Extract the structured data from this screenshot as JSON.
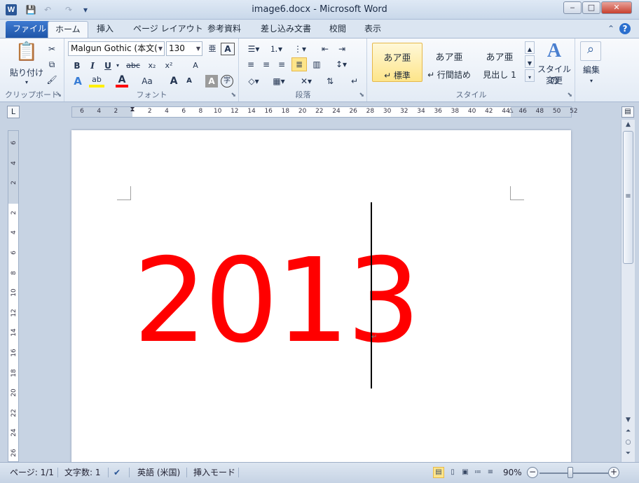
{
  "window": {
    "title": "image6.docx - Microsoft Word",
    "app_icon": "W",
    "controls": {
      "minimize": "‒",
      "maximize": "□",
      "close": "✕"
    }
  },
  "quick_access": {
    "save": "💾",
    "undo": "↶",
    "redo": "↷",
    "customize": "▾"
  },
  "tabs": [
    {
      "label": "ファイル"
    },
    {
      "label": "ホーム"
    },
    {
      "label": "挿入"
    },
    {
      "label": "ページ レイアウト"
    },
    {
      "label": "参考資料"
    },
    {
      "label": "差し込み文書"
    },
    {
      "label": "校閲"
    },
    {
      "label": "表示"
    }
  ],
  "ribbon": {
    "clipboard": {
      "group_label": "クリップボード",
      "paste_label": "貼り付け",
      "cut_icon": "✂",
      "copy_icon": "⧉",
      "painter_icon": "🖌"
    },
    "font": {
      "group_label": "フォント",
      "font_name": "Malgun Gothic (本文(",
      "font_size": "130",
      "bold": "B",
      "italic": "I",
      "underline": "U",
      "strike": "abc",
      "subscript": "x₂",
      "superscript": "x²",
      "grow": "A",
      "shrink": "A",
      "case": "Aa",
      "clear": "A",
      "phonetic": "亜",
      "border_char": "A",
      "enclose": "字",
      "text_effect": "A",
      "highlight": "ab",
      "font_color": "A",
      "char_shading": "A"
    },
    "paragraph": {
      "group_label": "段落"
    },
    "styles": {
      "group_label": "スタイル",
      "items": [
        {
          "sample": "あア亜",
          "name": "↵ 標準"
        },
        {
          "sample": "あア亜",
          "name": "↵ 行間詰め"
        },
        {
          "sample": "あア亜",
          "name": "見出し 1"
        }
      ],
      "change_label_1": "スタイルの",
      "change_label_2": "変更"
    },
    "editing": {
      "label": "編集"
    }
  },
  "rulers": {
    "horizontal_ticks": [
      "6",
      "4",
      "2",
      "2",
      "4",
      "6",
      "8",
      "10",
      "12",
      "14",
      "16",
      "18",
      "20",
      "22",
      "24",
      "26",
      "28",
      "30",
      "32",
      "34",
      "36",
      "38",
      "40",
      "42",
      "44",
      "46",
      "48",
      "50",
      "52"
    ],
    "vertical_ticks": [
      "6",
      "4",
      "2",
      "2",
      "4",
      "6",
      "8",
      "10",
      "12",
      "14",
      "16",
      "18",
      "20",
      "22",
      "24",
      "26"
    ],
    "tab_selector": "L"
  },
  "document": {
    "text": "2013",
    "text_color": "#ff0000",
    "para_mark": "↵"
  },
  "statusbar": {
    "page": "ページ: 1/1",
    "word_count": "文字数: 1",
    "language": "英語 (米国)",
    "mode": "挿入モード",
    "zoom": "90%",
    "zoom_level_percent": 90
  }
}
